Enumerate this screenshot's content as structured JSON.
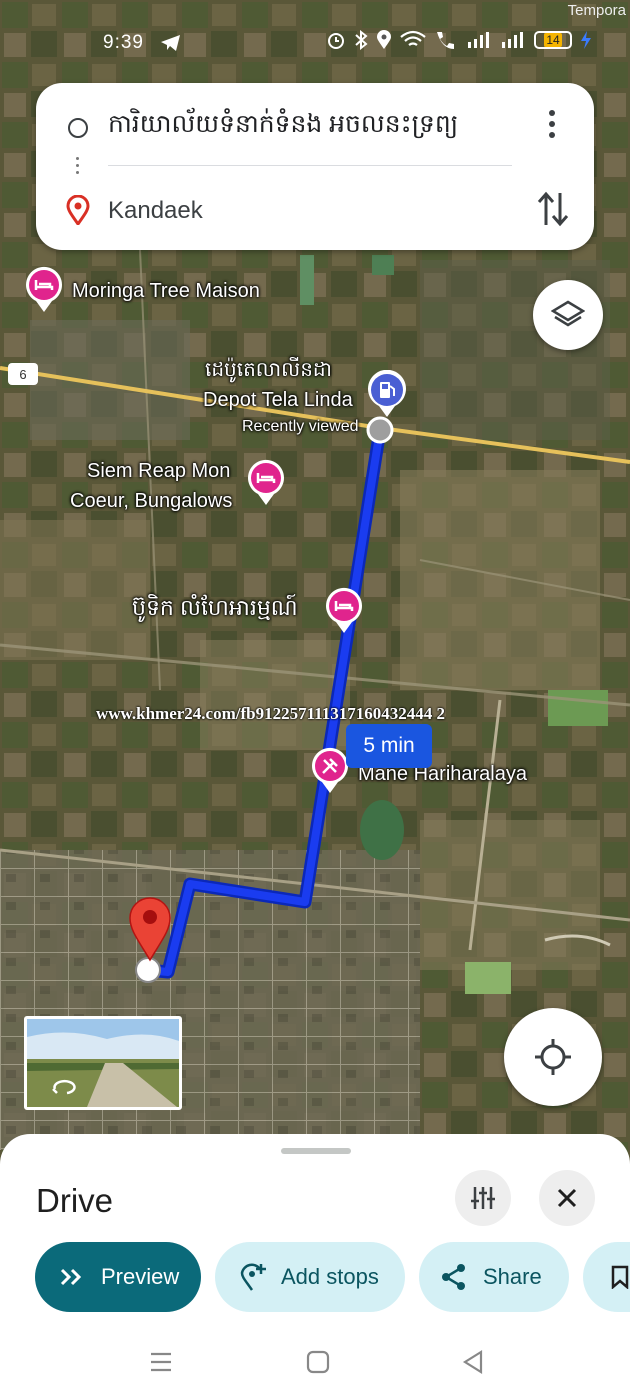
{
  "status_bar": {
    "time": "9:39",
    "top_right_text": "Tempora",
    "battery": "14"
  },
  "directions": {
    "origin": "ការិយាល័យទំនាក់ទំនង អចលនះទ្រព្យ",
    "destination": "Kandaek"
  },
  "map": {
    "route_highway": "6",
    "pois": {
      "moringa": "Moringa Tree Maison",
      "depot_khmer": "ដេប៉ូតេលាលីនដា",
      "depot_en": "Depot Tela Linda",
      "recently_viewed": "Recently viewed",
      "siem_reap_line1": "Siem Reap Mon",
      "siem_reap_line2": "Coeur, Bungalows",
      "boutique_khmer": "ប៊ូទិក លំហែអារម្មណ៍",
      "mane": "Mane Hariharalaya"
    },
    "watermark": "www.khmer24.com/fb912257111317160432444 2",
    "eta": "5 min"
  },
  "sheet": {
    "title": "Drive",
    "buttons": {
      "preview": "Preview",
      "add_stops": "Add stops",
      "share": "Share"
    }
  },
  "colors": {
    "route": "#1a3cf0",
    "accent": "#0b6a7a",
    "chip_bg": "#d4f0f5",
    "poi_pink": "#e0248d",
    "gas_blue": "#4a5fd3"
  }
}
